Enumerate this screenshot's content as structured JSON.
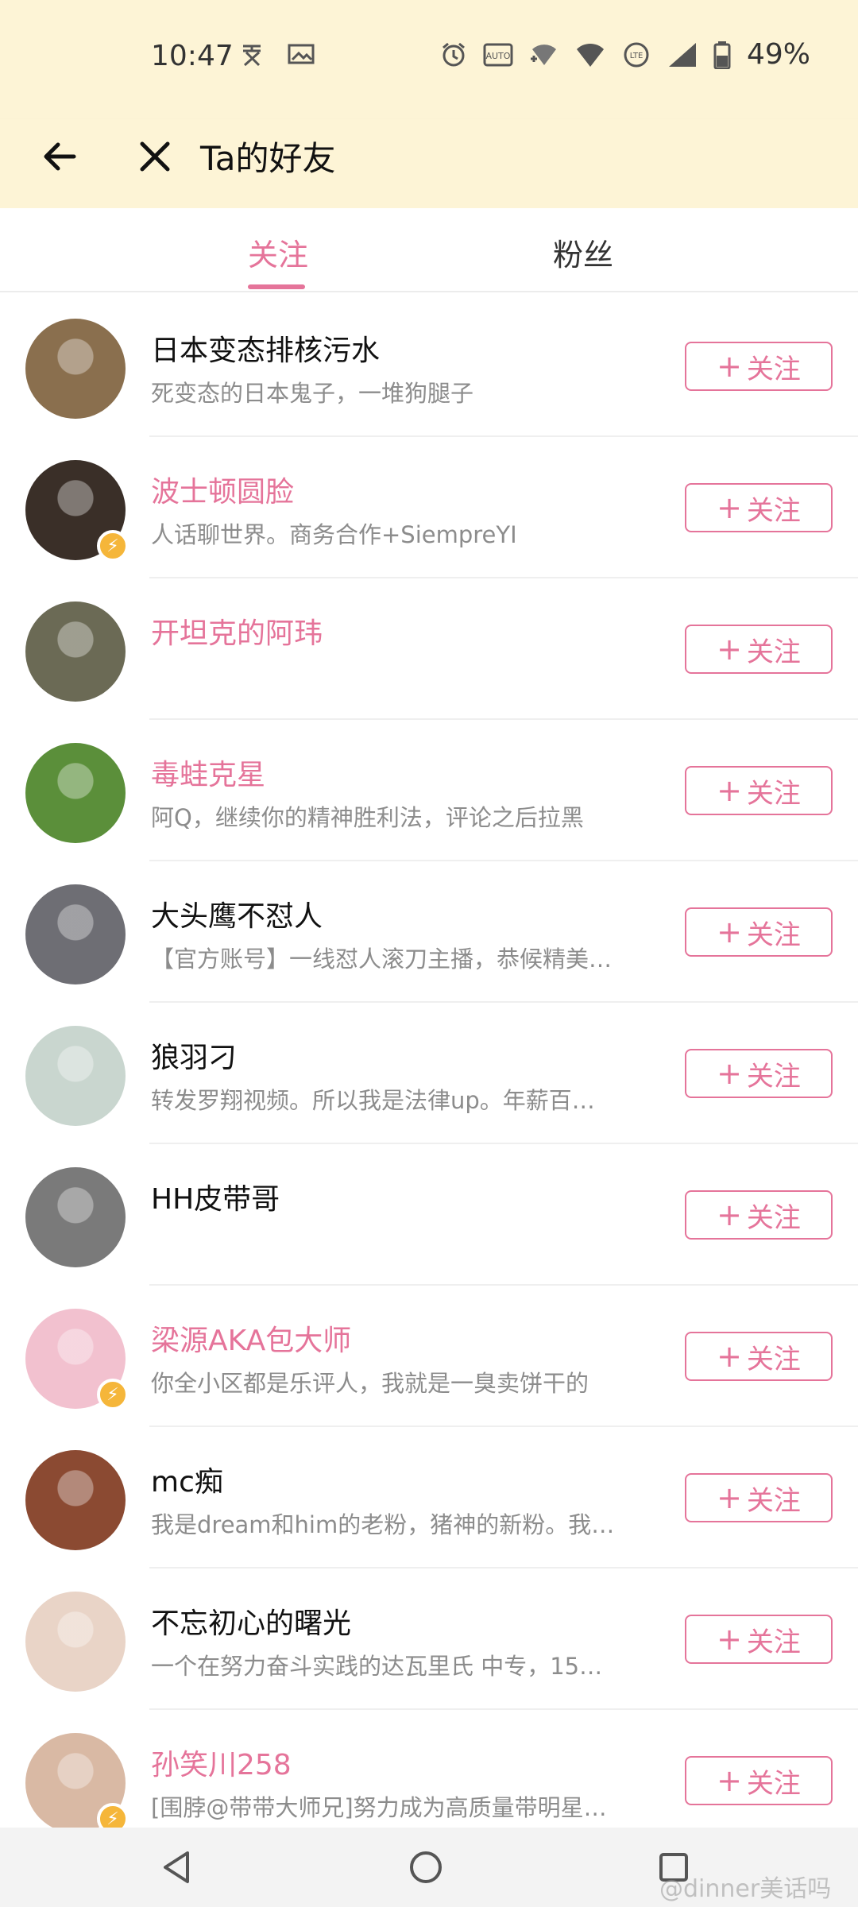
{
  "status_bar": {
    "time": "10:47",
    "battery": "49%",
    "icons": [
      "alarm-icon",
      "auto-hz-icon",
      "wifi-plus-icon",
      "wifi-icon",
      "volte-icon",
      "signal-icon",
      "battery-icon"
    ]
  },
  "header": {
    "title": "Ta的好友"
  },
  "tabs": [
    {
      "label": "关注",
      "active": true
    },
    {
      "label": "粉丝",
      "active": false
    }
  ],
  "follow_button_label": "关注",
  "users": [
    {
      "name": "日本变态排核污水",
      "bio": "死变态的日本鬼子，一堆狗腿子",
      "name_color": "black",
      "verified": false,
      "avatar_color": "#8a6f4e"
    },
    {
      "name": "波士顿圆脸",
      "bio": "人话聊世界。商务合作+SiempreYI",
      "name_color": "pink",
      "verified": true,
      "avatar_color": "#3a2f28"
    },
    {
      "name": "开坦克的阿玮",
      "bio": "",
      "name_color": "pink",
      "verified": false,
      "avatar_color": "#6b6a55"
    },
    {
      "name": "毒蛙克星",
      "bio": "阿Q，继续你的精神胜利法，评论之后拉黑",
      "name_color": "pink",
      "verified": false,
      "avatar_color": "#5b8f3a"
    },
    {
      "name": "大头鹰不怼人",
      "bio": "【官方账号】一线怼人滚刀主播，恭候精美…",
      "name_color": "black",
      "verified": false,
      "avatar_color": "#6e6e74"
    },
    {
      "name": "狼羽刁",
      "bio": "转发罗翔视频。所以我是法律up。年薪百…",
      "name_color": "black",
      "verified": false,
      "avatar_color": "#c9d6cf"
    },
    {
      "name": "HH皮带哥",
      "bio": "",
      "name_color": "black",
      "verified": false,
      "avatar_color": "#7a7a7a"
    },
    {
      "name": "梁源AKA包大师",
      "bio": "你全小区都是乐评人，我就是一臭卖饼干的",
      "name_color": "pink",
      "verified": true,
      "avatar_color": "#f2c1cf"
    },
    {
      "name": "mc痴",
      "bio": "我是dream和him的老粉，猪神的新粉。我…",
      "name_color": "black",
      "verified": false,
      "avatar_color": "#8b4a32"
    },
    {
      "name": "不忘初心的曙光",
      "bio": "一个在努力奋斗实践的达瓦里氏 中专，15…",
      "name_color": "black",
      "verified": false,
      "avatar_color": "#e9d4c7"
    },
    {
      "name": "孙笑川258",
      "bio": "[围脖@带带大师兄]努力成为高质量带明星…",
      "name_color": "pink",
      "verified": true,
      "avatar_color": "#d9b9a4"
    }
  ],
  "watermark": "@dinner美话吗"
}
